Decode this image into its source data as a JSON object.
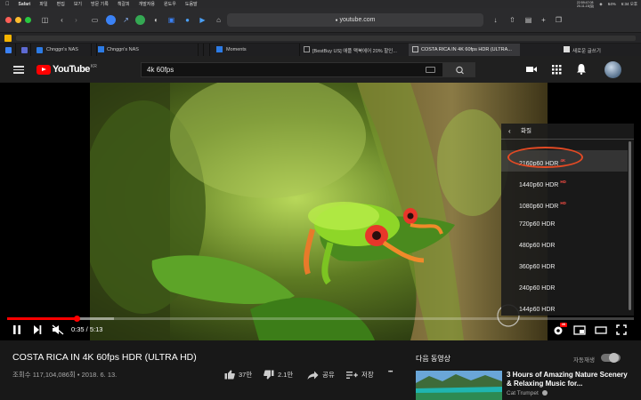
{
  "menubar": {
    "app": "Safari",
    "items": [
      "파일",
      "편집",
      "보기",
      "방문 기록",
      "책갈피",
      "개발자용",
      "윈도우",
      "도움말"
    ],
    "status_date": "20-11-15(일)",
    "status_time": "22:59:47:08",
    "battery": "64%",
    "clock": "6:34 오후"
  },
  "safari": {
    "address": "youtube.com",
    "tabs": [
      {
        "label": "",
        "active": false
      },
      {
        "label": "Chnggn's NAS",
        "active": false
      },
      {
        "label": "Moments",
        "active": false
      },
      {
        "label": "[BestBuy US] 애플 맥북에어 20% 할인...",
        "active": false
      },
      {
        "label": "COSTA RICA IN 4K 60fps HDR (ULTRA...",
        "active": true
      },
      {
        "label": "새로운 글쓰기",
        "active": false
      }
    ]
  },
  "youtube": {
    "logo_text": "YouTube",
    "logo_region": "KR",
    "search_value": "4k 60fps"
  },
  "player": {
    "current_time": "0:35",
    "duration": "5:13",
    "time_display": "0:35 / 5:13",
    "progress_fraction": 0.112,
    "buffered_fraction": 0.17,
    "hd_badge": "4K",
    "quality_menu": {
      "header": "화질",
      "options": [
        {
          "label": "2160p60 HDR",
          "badge": "4K",
          "selected": true
        },
        {
          "label": "1440p60 HDR",
          "badge": "HD",
          "selected": false
        },
        {
          "label": "1080p60 HDR",
          "badge": "HD",
          "selected": false
        },
        {
          "label": "720p60 HDR",
          "badge": "",
          "selected": false
        },
        {
          "label": "480p60 HDR",
          "badge": "",
          "selected": false
        },
        {
          "label": "360p60 HDR",
          "badge": "",
          "selected": false
        },
        {
          "label": "240p60 HDR",
          "badge": "",
          "selected": false
        },
        {
          "label": "144p60 HDR",
          "badge": "",
          "selected": false
        }
      ]
    }
  },
  "video": {
    "title": "COSTA RICA IN 4K 60fps HDR (ULTRA HD)",
    "meta": "조회수 117,104,086회 • 2018. 6. 13.",
    "likes": "37만",
    "dislikes": "2.1만",
    "share": "공유",
    "save": "저장",
    "more": "•••"
  },
  "sidebar": {
    "up_next": "다음 동영상",
    "autoplay": "자동재생",
    "recommended": {
      "title": "3 Hours of Amazing Nature Scenery & Relaxing Music for...",
      "channel": "Cat Trumpet"
    }
  },
  "colors": {
    "youtube_red": "#ff0000",
    "highlight_oval": "#e24a24",
    "hd_badge": "#ff4e45"
  }
}
